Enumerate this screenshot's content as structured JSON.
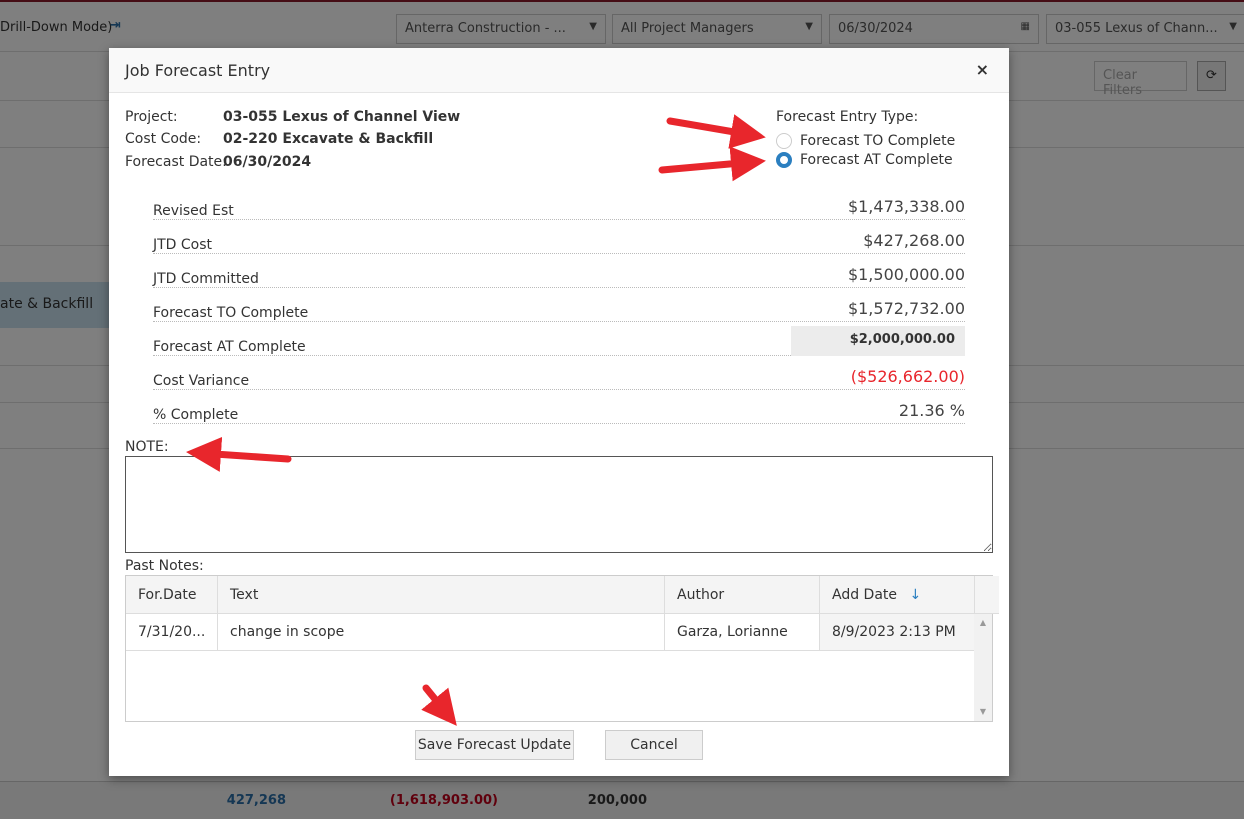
{
  "background": {
    "mode_text": "Drill-Down Mode)",
    "company": "Anterra Construction - ...",
    "managers": "All Project Managers",
    "date": "06/30/2024",
    "project": "03-055 Lexus of Chann...",
    "clear_filters": "Clear Filters",
    "selected_row": "ate & Backfill",
    "footer": {
      "jtd": "427,268",
      "variance": "(1,618,903.00)",
      "other": "200,000"
    }
  },
  "modal": {
    "title": "Job Forecast Entry",
    "close": "×",
    "project_label": "Project:",
    "project": "03-055 Lexus of Channel View",
    "cost_code_label": "Cost Code:",
    "cost_code": "02-220 Excavate & Backfill",
    "forecast_date_label": "Forecast Date:",
    "forecast_date": "06/30/2024",
    "entry_type_label": "Forecast Entry Type:",
    "entry_types": [
      {
        "label": "Forecast TO Complete",
        "selected": false
      },
      {
        "label": "Forecast AT Complete",
        "selected": true
      }
    ],
    "rows": [
      {
        "label": "Revised Est",
        "value": "$1,473,338.00"
      },
      {
        "label": "JTD Cost",
        "value": "$427,268.00"
      },
      {
        "label": "JTD Committed",
        "value": "$1,500,000.00"
      },
      {
        "label": "Forecast TO Complete",
        "value": "$1,572,732.00"
      },
      {
        "label": "Forecast AT Complete",
        "value": "$2,000,000.00"
      },
      {
        "label": "Cost Variance",
        "value": "($526,662.00)"
      },
      {
        "label": "% Complete",
        "value": "21.36 %"
      }
    ],
    "note_label": "NOTE:",
    "note_value": "",
    "past_notes_label": "Past Notes:",
    "past_notes": {
      "columns": [
        "For.Date",
        "Text",
        "Author",
        "Add Date"
      ],
      "sort_icon": "↓",
      "rows": [
        [
          "7/31/20...",
          "change in scope",
          "Garza, Lorianne",
          "8/9/2023 2:13 PM"
        ]
      ]
    },
    "save": "Save Forecast Update",
    "cancel": "Cancel"
  },
  "colors": {
    "accent": "#2b7fc0",
    "negative": "#e8262c",
    "arrow": "#e8262c"
  }
}
